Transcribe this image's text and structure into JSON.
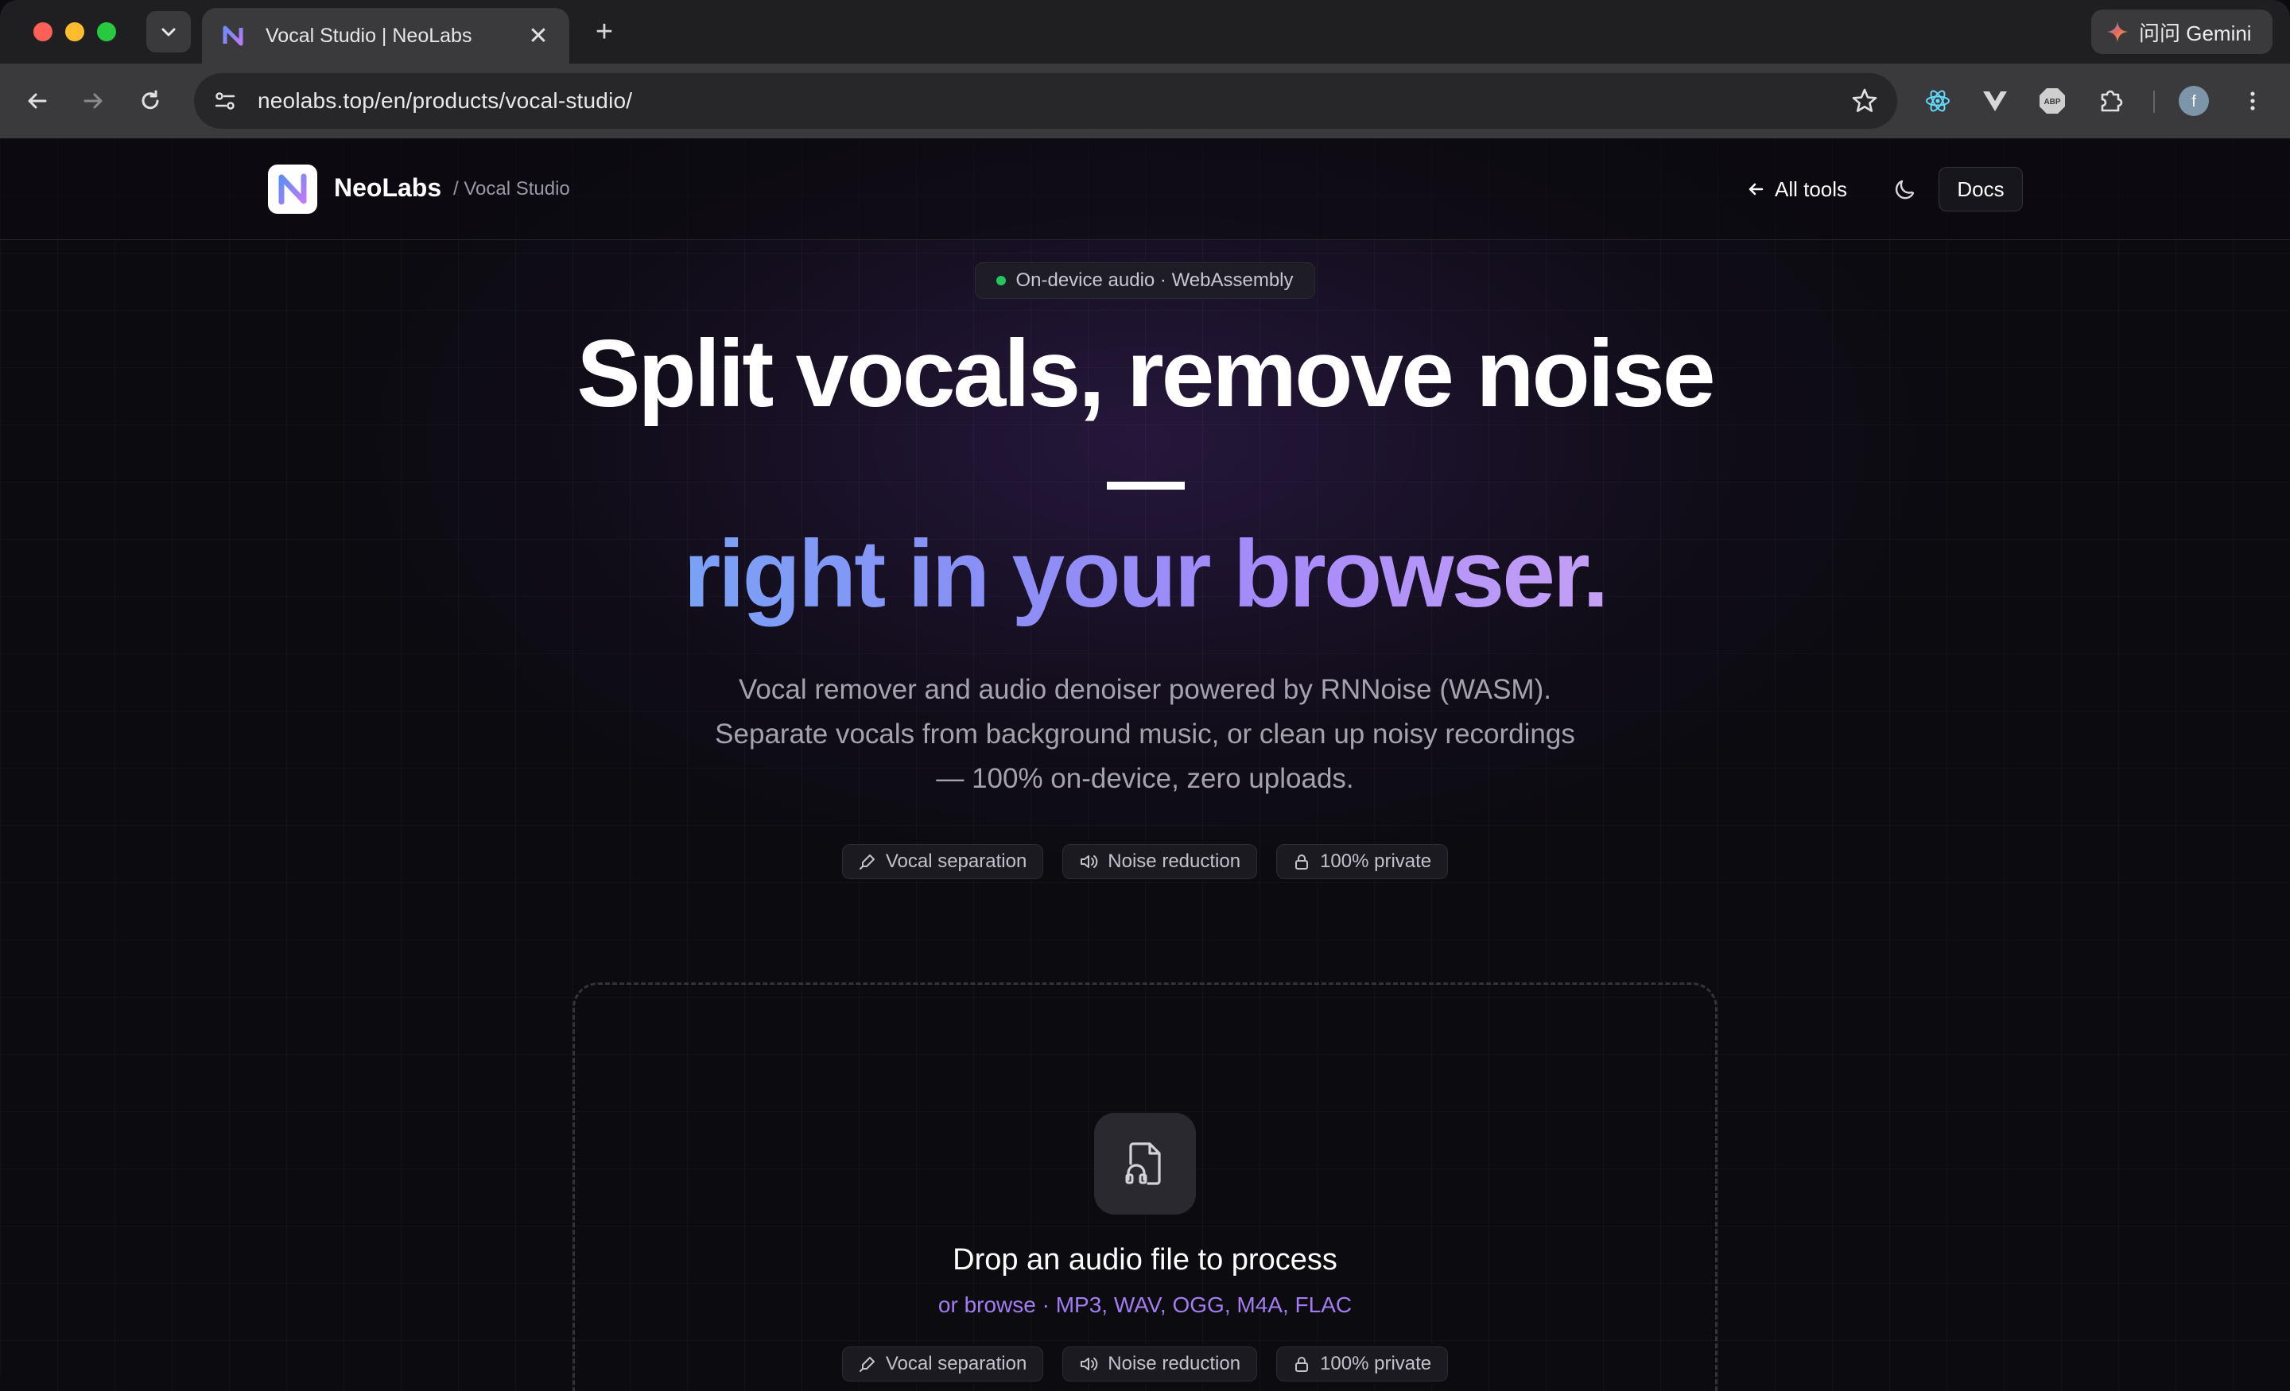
{
  "browser": {
    "tab_title": "Vocal Studio | NeoLabs",
    "tab_close": "✕",
    "new_tab": "+",
    "gemini_label": "问问 Gemini",
    "url": "neolabs.top/en/products/vocal-studio/",
    "profile_initial": "f"
  },
  "header": {
    "brand_name": "NeoLabs",
    "breadcrumb": "/ Vocal Studio",
    "all_tools": "All tools",
    "docs": "Docs"
  },
  "hero": {
    "badge": "On-device audio · WebAssembly",
    "title_line1": "Split vocals, remove noise",
    "title_line2": "right in your browser.",
    "subtitle_lines": [
      "Vocal remover and audio denoiser powered by RNNoise (WASM).",
      "Separate vocals from background music, or clean up noisy recordings",
      "— 100% on-device, zero uploads."
    ],
    "features": [
      "Vocal separation",
      "Noise reduction",
      "100% private"
    ]
  },
  "dropzone": {
    "title": "Drop an audio file to process",
    "formats": "or browse · MP3, WAV, OGG, M4A, FLAC",
    "features": [
      "Vocal separation",
      "Noise reduction",
      "100% private"
    ]
  },
  "colors": {
    "accent_purple": "#a37cf2",
    "status_green": "#22c55e",
    "gradient_start": "#7aa2f7",
    "gradient_end": "#c4a0f5"
  }
}
